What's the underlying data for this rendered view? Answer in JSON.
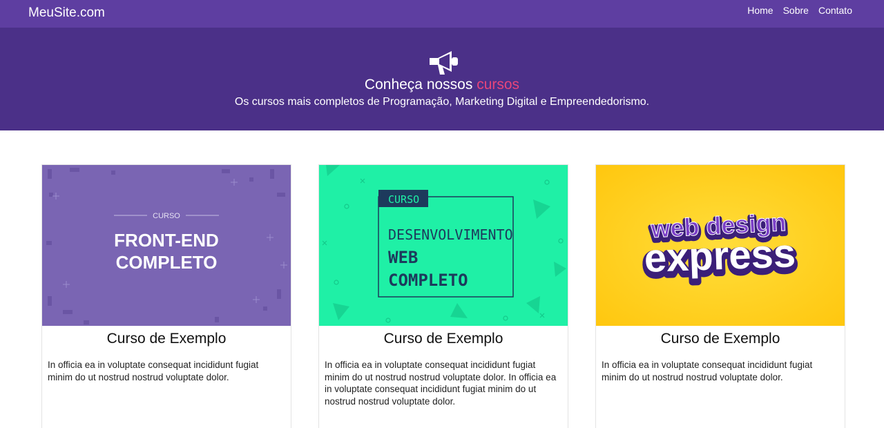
{
  "navbar": {
    "brand": "MeuSite.com",
    "links": [
      "Home",
      "Sobre",
      "Contato"
    ]
  },
  "hero": {
    "icon": "megaphone-icon",
    "title_prefix": "Conheça nossos ",
    "title_highlight": "cursos",
    "subtitle": "Os cursos mais completos de Programação, Marketing Digital e Empreendedorismo."
  },
  "cards": [
    {
      "image": {
        "label_top": "CURSO",
        "line1": "FRONT-END",
        "line2": "COMPLETO"
      },
      "title": "Curso de Exemplo",
      "text": "In officia ea in voluptate consequat incididunt fugiat minim do ut nostrud nostrud voluptate dolor."
    },
    {
      "image": {
        "label_top": "CURSO",
        "line1": "DESENVOLVIMENTO",
        "line2": "WEB",
        "line3": "COMPLETO"
      },
      "title": "Curso de Exemplo",
      "text": "In officia ea in voluptate consequat incididunt fugiat minim do ut nostrud nostrud voluptate dolor. In officia ea in voluptate consequat incididunt fugiat minim do ut nostrud nostrud voluptate dolor."
    },
    {
      "image": {
        "line1": "web design",
        "line2": "express"
      },
      "title": "Curso de Exemplo",
      "text": "In officia ea in voluptate consequat incididunt fugiat minim do ut nostrud nostrud voluptate dolor."
    }
  ],
  "colors": {
    "navbar": "#5e3ea1",
    "hero": "#4b3088",
    "highlight": "#e8457a",
    "card1_bg": "#7a65b3",
    "card2_bg": "#1ff0a6",
    "card3_bg": "#ffcd1e"
  }
}
